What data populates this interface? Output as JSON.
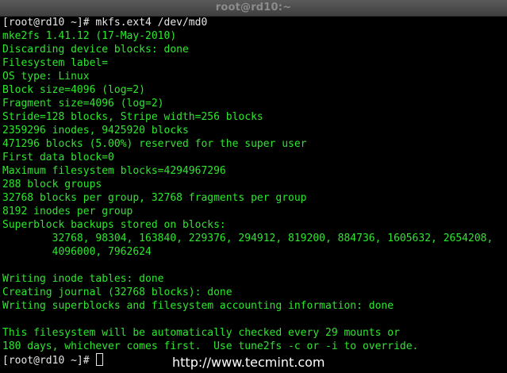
{
  "window": {
    "title": "root@rd10:~"
  },
  "terminal": {
    "prompt1": {
      "ps1": "[root@rd10 ~]# ",
      "command": "mkfs.ext4 /dev/md0"
    },
    "output": [
      "mke2fs 1.41.12 (17-May-2010)",
      "Discarding device blocks: done",
      "Filesystem label=",
      "OS type: Linux",
      "Block size=4096 (log=2)",
      "Fragment size=4096 (log=2)",
      "Stride=128 blocks, Stripe width=256 blocks",
      "2359296 inodes, 9425920 blocks",
      "471296 blocks (5.00%) reserved for the super user",
      "First data block=0",
      "Maximum filesystem blocks=4294967296",
      "288 block groups",
      "32768 blocks per group, 32768 fragments per group",
      "8192 inodes per group",
      "Superblock backups stored on blocks:",
      "        32768, 98304, 163840, 229376, 294912, 819200, 884736, 1605632, 2654208,",
      "        4096000, 7962624",
      "",
      "Writing inode tables: done",
      "Creating journal (32768 blocks): done",
      "Writing superblocks and filesystem accounting information: done",
      "",
      "This filesystem will be automatically checked every 29 mounts or",
      "180 days, whichever comes first.  Use tune2fs -c or -i to override."
    ],
    "prompt2": {
      "ps1": "[root@rd10 ~]# "
    }
  },
  "watermark": {
    "text": "http://www.tecmint.com"
  }
}
